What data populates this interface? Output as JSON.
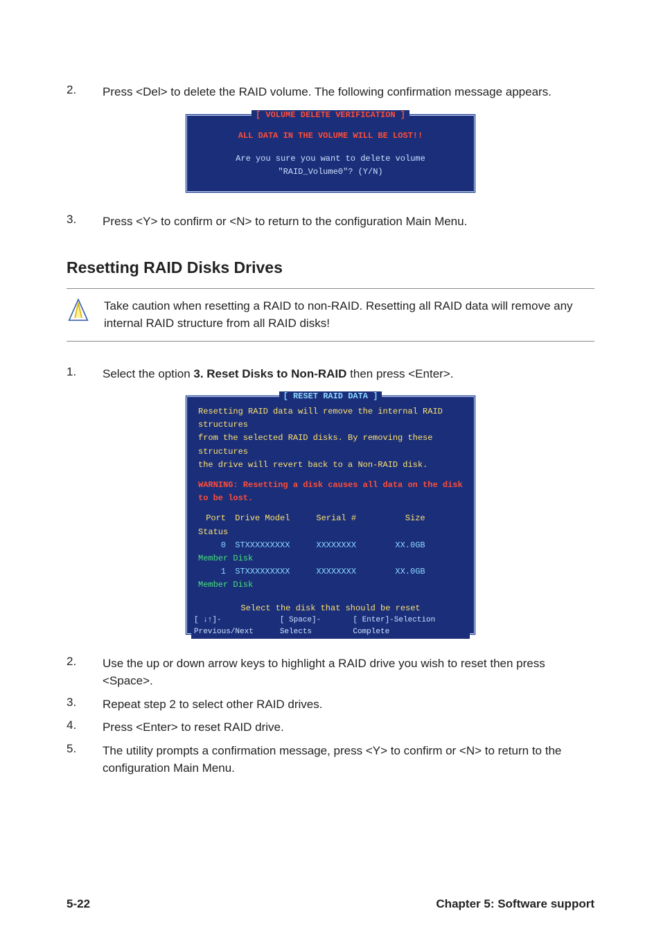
{
  "step2": {
    "num": "2.",
    "text": "Press <Del> to delete the RAID volume. The following confirmation message appears."
  },
  "console1": {
    "title": "[ VOLUME DELETE VERIFICATION ]",
    "warn": "ALL DATA IN THE VOLUME WILL BE LOST!!",
    "prompt": "Are you sure you want to delete volume \"RAID_Volume0\"? (Y/N)"
  },
  "step3": {
    "num": "3.",
    "text": "Press <Y> to confirm or <N> to return to the configuration Main Menu."
  },
  "section_heading": "Resetting RAID Disks Drives",
  "note": "Take caution when resetting a RAID to non-RAID. Resetting all RAID data will remove any internal RAID structure from all RAID disks!",
  "stepB1": {
    "num": "1.",
    "pre": "Select the option ",
    "bold": "3. Reset Disks to Non-RAID",
    "post": " then press <Enter>."
  },
  "console2": {
    "title": "[ RESET RAID DATA ]",
    "body1": "Resetting RAID data will remove the internal RAID structures",
    "body2": "from the selected RAID disks. By removing these structures",
    "body3": "the drive will revert back to a Non-RAID disk.",
    "warn": "WARNING: Resetting a disk causes all data on the disk to be lost.",
    "headers": {
      "port": "Port",
      "model": "Drive Model",
      "serial": "Serial #",
      "size": "Size",
      "status": "Status"
    },
    "rows": [
      {
        "port": "0",
        "model": "STXXXXXXXXX",
        "serial": "XXXXXXXX",
        "size": "XX.0GB",
        "status": "Member Disk"
      },
      {
        "port": "1",
        "model": "STXXXXXXXXX",
        "serial": "XXXXXXXX",
        "size": "XX.0GB",
        "status": "Member Disk"
      }
    ],
    "select_msg": "Select the disk that should be reset",
    "foot_left": "[ ↓↑]-Previous/Next",
    "foot_mid": "[ Space]-Selects",
    "foot_right": "[ Enter]-Selection Complete"
  },
  "stepB2": {
    "num": "2.",
    "text": "Use the up or down arrow keys to highlight a RAID drive you wish to reset then press <Space>."
  },
  "stepB3": {
    "num": "3.",
    "text": "Repeat step 2 to select other RAID drives."
  },
  "stepB4": {
    "num": "4.",
    "text": "Press <Enter> to reset RAID drive."
  },
  "stepB5": {
    "num": "5.",
    "text": "The utility prompts a confirmation message, press <Y> to confirm or <N> to return to the configuration Main Menu."
  },
  "footer": {
    "left": "5-22",
    "right": "Chapter 5: Software support"
  }
}
